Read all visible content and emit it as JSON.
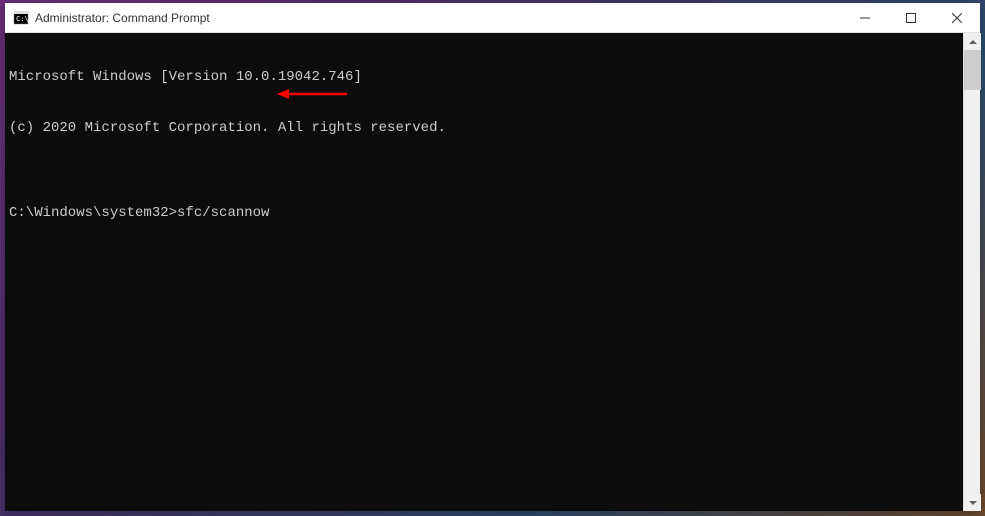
{
  "window": {
    "title": "Administrator: Command Prompt"
  },
  "terminal": {
    "line1": "Microsoft Windows [Version 10.0.19042.746]",
    "line2": "(c) 2020 Microsoft Corporation. All rights reserved.",
    "blank": "",
    "prompt": "C:\\Windows\\system32>",
    "command": "sfc/scannow"
  },
  "annotation": {
    "color": "#ff0000"
  }
}
